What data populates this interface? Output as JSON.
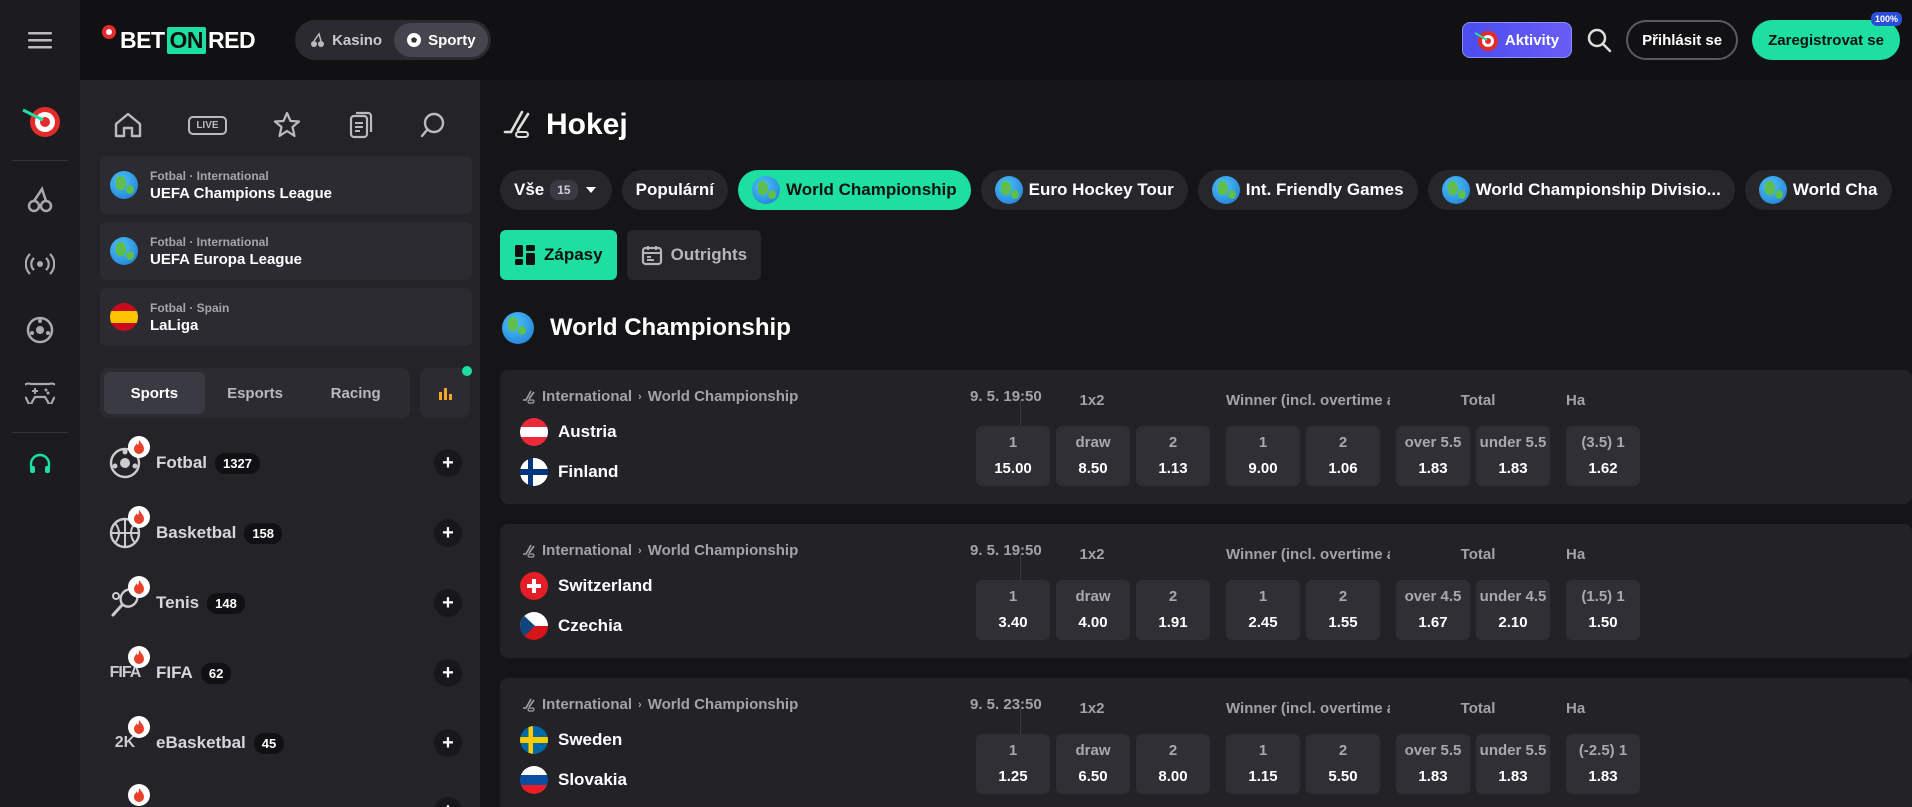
{
  "header": {
    "logo_bet": "BET",
    "logo_on": "ON",
    "logo_red": "RED",
    "mode_casino": "Kasino",
    "mode_sports": "Sporty",
    "aktivity": "Aktivity",
    "login": "Přihlásit se",
    "register": "Zaregistrovat se",
    "register_badge": "100%"
  },
  "sidebar": {
    "leagues": [
      {
        "sport": "Fotbal · International",
        "name": "UEFA Champions League"
      },
      {
        "sport": "Fotbal · International",
        "name": "UEFA Europa League"
      },
      {
        "sport": "Fotbal · Spain",
        "name": "LaLiga"
      }
    ],
    "tabs": [
      "Sports",
      "Esports",
      "Racing"
    ],
    "live_badge": "LIVE",
    "sports": [
      {
        "name": "Fotbal",
        "count": "1327"
      },
      {
        "name": "Basketbal",
        "count": "158"
      },
      {
        "name": "Tenis",
        "count": "148"
      },
      {
        "name": "FIFA",
        "count": "62"
      },
      {
        "name": "eBasketbal",
        "count": "45"
      }
    ]
  },
  "main": {
    "title": "Hokej",
    "chips": {
      "all": "Vše",
      "all_count": "15",
      "popular": "Populární",
      "c1": "World Championship",
      "c2": "Euro Hockey Tour",
      "c3": "Int. Friendly Games",
      "c4": "World Championship Divisio...",
      "c5": "World Cha"
    },
    "view_tabs": [
      "Zápasy",
      "Outrights"
    ],
    "section": "World Championship",
    "matches": [
      {
        "cat": "International",
        "comp": "World Championship",
        "date": "9. 5. 19:50",
        "home": "Austria",
        "away": "Finland",
        "m1": "1x2",
        "m2": "Winner (incl. overtime a",
        "m3": "Total",
        "m4": "Ha",
        "o": [
          {
            "l": "1",
            "v": "15.00"
          },
          {
            "l": "draw",
            "v": "8.50"
          },
          {
            "l": "2",
            "v": "1.13"
          },
          {
            "l": "1",
            "v": "9.00"
          },
          {
            "l": "2",
            "v": "1.06"
          },
          {
            "l": "over 5.5",
            "v": "1.83"
          },
          {
            "l": "under 5.5",
            "v": "1.83"
          },
          {
            "l": "(3.5) 1",
            "v": "1.62"
          }
        ]
      },
      {
        "cat": "International",
        "comp": "World Championship",
        "date": "9. 5. 19:50",
        "home": "Switzerland",
        "away": "Czechia",
        "m1": "1x2",
        "m2": "Winner (incl. overtime a",
        "m3": "Total",
        "m4": "Ha",
        "o": [
          {
            "l": "1",
            "v": "3.40"
          },
          {
            "l": "draw",
            "v": "4.00"
          },
          {
            "l": "2",
            "v": "1.91"
          },
          {
            "l": "1",
            "v": "2.45"
          },
          {
            "l": "2",
            "v": "1.55"
          },
          {
            "l": "over 4.5",
            "v": "1.67"
          },
          {
            "l": "under 4.5",
            "v": "2.10"
          },
          {
            "l": "(1.5) 1",
            "v": "1.50"
          }
        ]
      },
      {
        "cat": "International",
        "comp": "World Championship",
        "date": "9. 5. 23:50",
        "home": "Sweden",
        "away": "Slovakia",
        "m1": "1x2",
        "m2": "Winner (incl. overtime a",
        "m3": "Total",
        "m4": "Ha",
        "o": [
          {
            "l": "1",
            "v": "1.25"
          },
          {
            "l": "draw",
            "v": "6.50"
          },
          {
            "l": "2",
            "v": "8.00"
          },
          {
            "l": "1",
            "v": "1.15"
          },
          {
            "l": "2",
            "v": "5.50"
          },
          {
            "l": "over 5.5",
            "v": "1.83"
          },
          {
            "l": "under 5.5",
            "v": "1.83"
          },
          {
            "l": "(-2.5) 1",
            "v": "1.83"
          }
        ]
      }
    ]
  },
  "colors": {
    "accent": "#1de0a0",
    "bg": "#151518",
    "panel": "#232328",
    "card": "#222227",
    "odd": "#2f2f35"
  }
}
